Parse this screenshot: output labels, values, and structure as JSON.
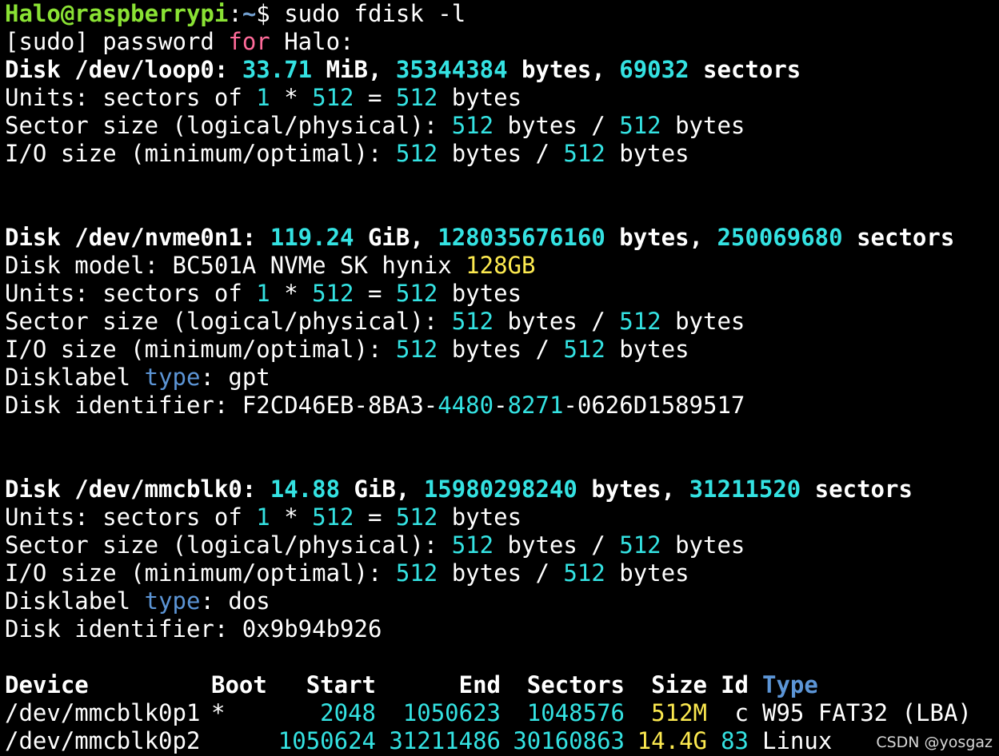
{
  "prompt": {
    "user_host": "Halo@raspberrypi",
    "colon": ":",
    "path": "~",
    "dollar": "$",
    "command": " sudo fdisk -l"
  },
  "sudo_prompt": {
    "pre": "[sudo] password ",
    "for": "for",
    "post": " Halo:"
  },
  "loop0": {
    "head": "Disk /dev/loop0: ",
    "size": "33.71",
    "unit": " MiB, ",
    "bytes": "35344384",
    "bytes_word": " bytes, ",
    "sectors": "69032",
    "sectors_word": " sectors",
    "units": {
      "a": "Units: sectors of ",
      "one": "1",
      "b": " * ",
      "n1": "512",
      "c": " = ",
      "n2": "512",
      "d": " bytes"
    },
    "sector_size": {
      "a": "Sector size (logical/physical): ",
      "n1": "512",
      "b": " bytes / ",
      "n2": "512",
      "c": " bytes"
    },
    "io_size": {
      "a": "I/O size (minimum/optimal): ",
      "n1": "512",
      "b": " bytes / ",
      "n2": "512",
      "c": " bytes"
    }
  },
  "nvme": {
    "head": "Disk /dev/nvme0n1: ",
    "size": "119.24",
    "unit": " GiB, ",
    "bytes": "128035676160",
    "bytes_word": " bytes, ",
    "sectors": "250069680",
    "sectors_word": " sectors",
    "model_pre": "Disk model: BC501A NVMe SK hynix ",
    "model_cap": "128GB",
    "units": {
      "a": "Units: sectors of ",
      "one": "1",
      "b": " * ",
      "n1": "512",
      "c": " = ",
      "n2": "512",
      "d": " bytes"
    },
    "sector_size": {
      "a": "Sector size (logical/physical): ",
      "n1": "512",
      "b": " bytes / ",
      "n2": "512",
      "c": " bytes"
    },
    "io_size": {
      "a": "I/O size (minimum/optimal): ",
      "n1": "512",
      "b": " bytes / ",
      "n2": "512",
      "c": " bytes"
    },
    "label": {
      "a": "Disklabel ",
      "type": "type",
      "b": ": gpt"
    },
    "identifier": {
      "a": "Disk identifier: F2CD46EB-8BA3-",
      "n1": "4480",
      "dash": "-",
      "n2": "8271",
      "b": "-0626D1589517"
    }
  },
  "mmc": {
    "head": "Disk /dev/mmcblk0: ",
    "size": "14.88",
    "unit": " GiB, ",
    "bytes": "15980298240",
    "bytes_word": " bytes, ",
    "sectors": "31211520",
    "sectors_word": " sectors",
    "units": {
      "a": "Units: sectors of ",
      "one": "1",
      "b": " * ",
      "n1": "512",
      "c": " = ",
      "n2": "512",
      "d": " bytes"
    },
    "sector_size": {
      "a": "Sector size (logical/physical): ",
      "n1": "512",
      "b": " bytes / ",
      "n2": "512",
      "c": " bytes"
    },
    "io_size": {
      "a": "I/O size (minimum/optimal): ",
      "n1": "512",
      "b": " bytes / ",
      "n2": "512",
      "c": " bytes"
    },
    "label": {
      "a": "Disklabel ",
      "type": "type",
      "b": ": dos"
    },
    "identifier": "Disk identifier: 0x9b94b926"
  },
  "partition_table": {
    "headers": {
      "device": "Device",
      "boot": "Boot",
      "start": "Start",
      "end": "End",
      "sectors": "Sectors",
      "size": "Size",
      "id": "Id",
      "type": "Type"
    },
    "rows": [
      {
        "device": "/dev/mmcblk0p1",
        "boot": "*",
        "start": "2048",
        "end": "1050623",
        "sectors": "1048576",
        "size": "512M",
        "id": "c",
        "type": "W95 FAT32 (LBA)"
      },
      {
        "device": "/dev/mmcblk0p2",
        "boot": "",
        "start": "1050624",
        "end": "31211486",
        "sectors": "30160863",
        "size": "14.4G",
        "id": "83",
        "type": "Linux"
      }
    ]
  },
  "watermark": "CSDN @yosgaz"
}
